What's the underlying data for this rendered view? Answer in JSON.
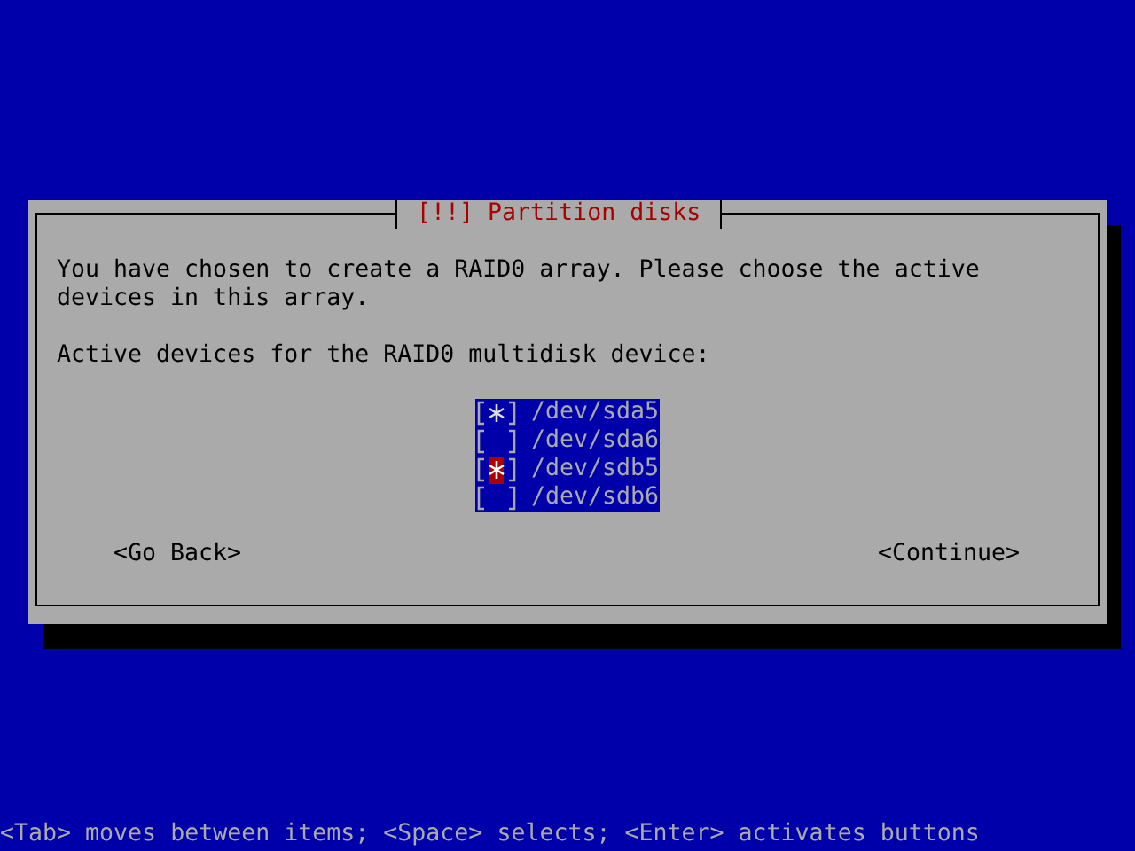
{
  "dialog": {
    "title": "[!!] Partition disks",
    "message": "You have chosen to create a RAID0 array. Please choose the active devices in this array.",
    "prompt": "Active devices for the RAID0 multidisk device:",
    "devices": [
      {
        "label": "/dev/sda5",
        "checked": true,
        "selected": false
      },
      {
        "label": "/dev/sda6",
        "checked": false,
        "selected": false
      },
      {
        "label": "/dev/sdb5",
        "checked": true,
        "selected": true
      },
      {
        "label": "/dev/sdb6",
        "checked": false,
        "selected": false
      }
    ],
    "buttons": [
      "<Go Back>",
      "<Continue>"
    ]
  },
  "help_line": "<Tab> moves between items; <Space> selects; <Enter> activates buttons"
}
